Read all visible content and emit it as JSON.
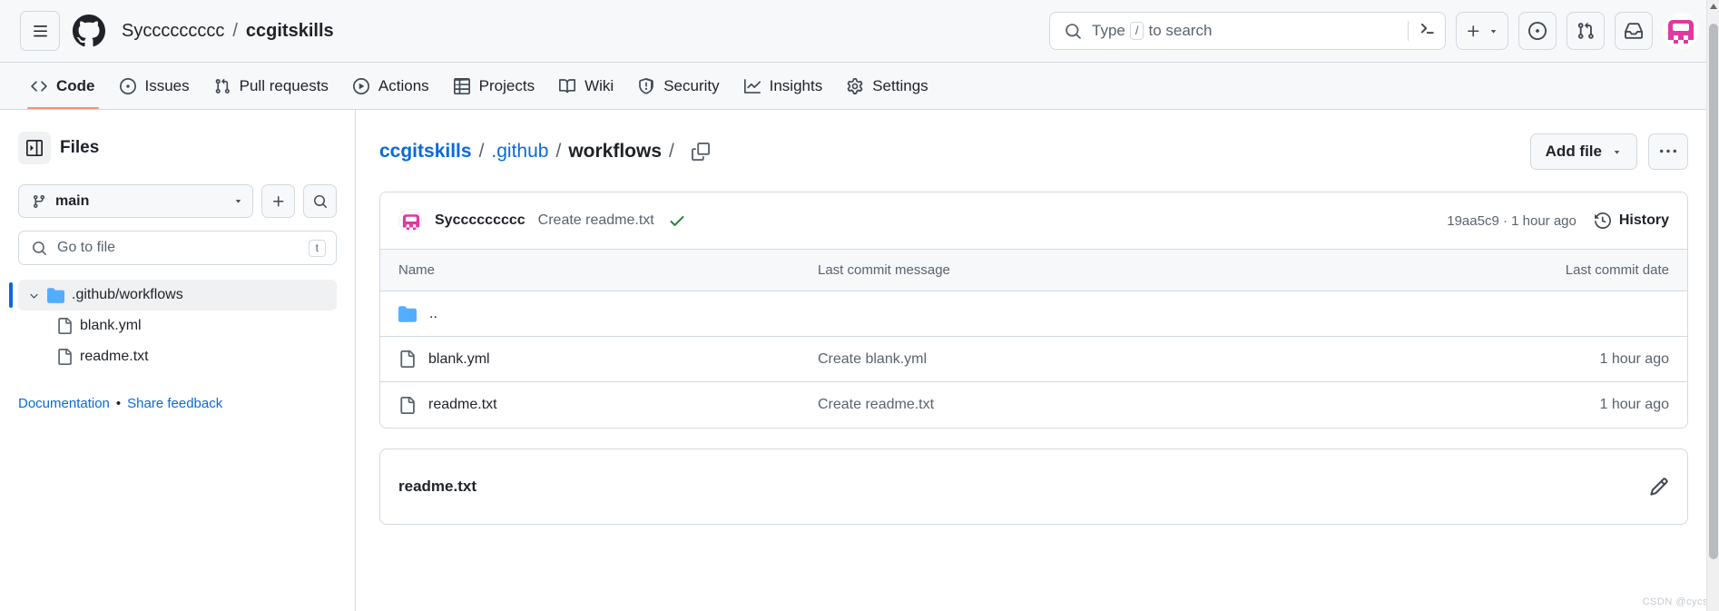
{
  "header": {
    "hamburger_label": "Open global navigation menu",
    "logo_label": "GitHub",
    "owner": "Syccccccccc",
    "separator": "/",
    "repo": "ccgitskills",
    "search_placeholder": "Type  to search",
    "search_prefix": "Type",
    "search_key": "/",
    "search_suffix": "to search",
    "create_new_label": "Create new...",
    "issues_label": "Your issues",
    "pull_requests_label": "Your pull requests",
    "inbox_label": "Notifications",
    "avatar_label": "Your profile"
  },
  "nav": {
    "tabs": [
      {
        "label": "Code",
        "icon": "code-icon",
        "active": true
      },
      {
        "label": "Issues",
        "icon": "issue-opened-icon",
        "active": false
      },
      {
        "label": "Pull requests",
        "icon": "git-pull-request-icon",
        "active": false
      },
      {
        "label": "Actions",
        "icon": "play-icon",
        "active": false
      },
      {
        "label": "Projects",
        "icon": "table-icon",
        "active": false
      },
      {
        "label": "Wiki",
        "icon": "book-icon",
        "active": false
      },
      {
        "label": "Security",
        "icon": "shield-icon",
        "active": false
      },
      {
        "label": "Insights",
        "icon": "graph-icon",
        "active": false
      },
      {
        "label": "Settings",
        "icon": "gear-icon",
        "active": false
      }
    ]
  },
  "sidebar": {
    "panel_title": "Files",
    "branch": "main",
    "add_label": "+",
    "search_label": "Search this repository",
    "goto_placeholder": "Go to file",
    "goto_key": "t",
    "tree": [
      {
        "name": ".github/workflows",
        "type": "folder",
        "selected": true,
        "expanded": true
      },
      {
        "name": "blank.yml",
        "type": "file",
        "selected": false
      },
      {
        "name": "readme.txt",
        "type": "file",
        "selected": false
      }
    ],
    "footer": {
      "documentation": "Documentation",
      "separator": "•",
      "feedback": "Share feedback"
    }
  },
  "main": {
    "breadcrumb": [
      {
        "label": "ccgitskills",
        "link": true,
        "bold": true
      },
      {
        "label": ".github",
        "link": true,
        "bold": false
      },
      {
        "label": "workflows",
        "link": false,
        "bold": true
      }
    ],
    "breadcrumb_separator": "/",
    "copy_path_label": "Copy path",
    "add_file_label": "Add file",
    "more_options_label": "More options",
    "commit": {
      "author": "Syccccccccc",
      "message": "Create readme.txt",
      "status": "check",
      "sha": "19aa5c9",
      "meta_separator": "·",
      "relative_time": "1 hour ago",
      "history_label": "History"
    },
    "table": {
      "columns": [
        "Name",
        "Last commit message",
        "Last commit date"
      ],
      "rows": [
        {
          "name": "..",
          "type": "folder-parent",
          "message": "",
          "date": ""
        },
        {
          "name": "blank.yml",
          "type": "file",
          "message": "Create blank.yml",
          "date": "1 hour ago"
        },
        {
          "name": "readme.txt",
          "type": "file",
          "message": "Create readme.txt",
          "date": "1 hour ago"
        }
      ]
    },
    "readme": {
      "title": "readme.txt",
      "edit_label": "Edit file"
    }
  },
  "watermark": "CSDN @cycs",
  "colors": {
    "accent_blue": "#0969da",
    "active_tab_underline": "#fd8c73",
    "header_bg": "#f6f8fa",
    "border": "#d1d9e0",
    "muted_text": "#59636e",
    "success_green": "#1a7f37",
    "folder_blue": "#54aeff",
    "avatar_pink": "#e0399f"
  }
}
